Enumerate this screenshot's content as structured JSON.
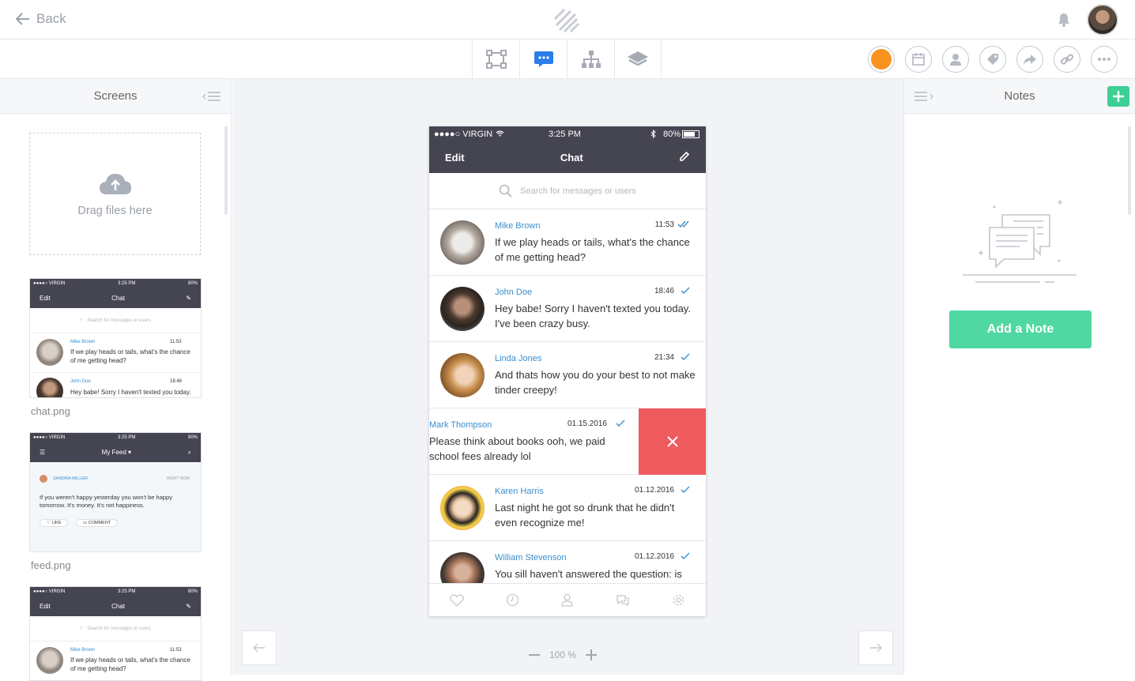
{
  "topbar": {
    "back_label": "Back"
  },
  "toolbar": {
    "tools": [
      "transform-tool",
      "comments-tool",
      "flow-tool",
      "layers-tool"
    ],
    "status_color": "#f7931e"
  },
  "left_panel": {
    "title": "Screens",
    "dropzone_label": "Drag files here",
    "screens": [
      {
        "file": "chat.png"
      },
      {
        "file": "feed.png"
      },
      {
        "file": ""
      }
    ]
  },
  "thumb_chat": {
    "carrier": "●●●●○ VIRGIN",
    "time": "3:25 PM",
    "battery": "80%",
    "edit": "Edit",
    "title": "Chat",
    "search": "Search for messages or users",
    "m1_name": "Mike Brown",
    "m1_time": "11:53",
    "m1_text": "If we play heads or tails, what's the chance of me getting head?",
    "m2_name": "John Doe",
    "m2_time": "18:46",
    "m2_text": "Hey babe! Sorry I haven't texted you today."
  },
  "thumb_feed": {
    "carrier": "●●●●○ VIRGIN",
    "time": "3:25 PM",
    "battery": "80%",
    "title": "My Feed ▾",
    "author": "SANDRA MILLER",
    "when": "RIGHT NOW",
    "text": "If you weren't happy yesterday you won't be happy tomorrow. It's money. It's not happiness.",
    "like": "LIKE",
    "comment": "COMMENT"
  },
  "phone": {
    "carrier": "●●●●○ VIRGIN",
    "time": "3:25 PM",
    "battery": "80%",
    "edit": "Edit",
    "title": "Chat",
    "search_placeholder": "Search for messages or users",
    "messages": [
      {
        "name": "Mike Brown",
        "time": "11:53",
        "text": "If we play heads or tails, what's the chance of me getting head?",
        "checks": "double"
      },
      {
        "name": "John Doe",
        "time": "18:46",
        "text": "Hey babe! Sorry I haven't texted you today. I've been crazy busy.",
        "checks": "single"
      },
      {
        "name": "Linda Jones",
        "time": "21:34",
        "text": "And thats how you do your best to not make tinder creepy!",
        "checks": "single"
      },
      {
        "name": "Mark Thompson",
        "time": "01.15.2016",
        "text": "Please think about books ooh, we paid school fees already lol",
        "checks": "single"
      },
      {
        "name": "Karen Harris",
        "time": "01.12.2016",
        "text": "Last night he got so drunk that he didn't even recognize me!",
        "checks": "single"
      },
      {
        "name": "William Stevenson",
        "time": "01.12.2016",
        "text": "You sill haven't answered the question: is",
        "checks": "single"
      }
    ]
  },
  "zoom": {
    "value": "100 %"
  },
  "right_panel": {
    "title": "Notes",
    "add_note_label": "Add a Note"
  },
  "colors": {
    "accent_blue": "#3a8ecd",
    "delete_red": "#ef5a5e",
    "note_green": "#4fd8a2",
    "dark_bar": "#454552"
  }
}
